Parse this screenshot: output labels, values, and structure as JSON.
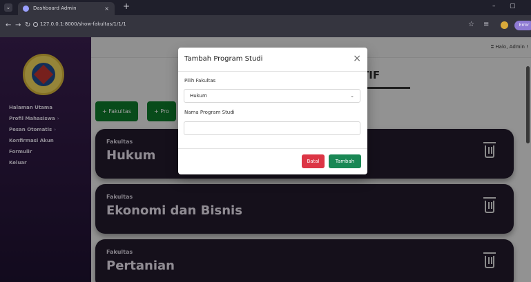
{
  "browser": {
    "tab_title": "Dashboard Admin",
    "tab_close": "×",
    "new_tab": "+",
    "url": "127.0.0.1:8000/show-fakultas/1/1/1",
    "error_badge": "Error",
    "win_min": "–",
    "win_max": "▢"
  },
  "header": {
    "greeting": "ⵓ Halo, Admin !"
  },
  "page": {
    "title": "TIF"
  },
  "sidebar": {
    "items": [
      {
        "label": "Halaman Utama",
        "chev": ""
      },
      {
        "label": "Profil Mahasiswa",
        "chev": "›"
      },
      {
        "label": "Pesan Otomatis",
        "chev": "›"
      },
      {
        "label": "Konfirmasi Akun",
        "chev": ""
      },
      {
        "label": "Formulir",
        "chev": ""
      },
      {
        "label": "Keluar",
        "chev": ""
      }
    ]
  },
  "buttons": {
    "add_faculty": "+ Fakultas",
    "add_program": "+ Pro"
  },
  "cards": [
    {
      "label": "Fakultas",
      "name": "Hukum"
    },
    {
      "label": "Fakultas",
      "name": "Ekonomi dan Bisnis"
    },
    {
      "label": "Fakultas",
      "name": "Pertanian"
    }
  ],
  "modal": {
    "title": "Tambah Program Studi",
    "close": "×",
    "faculty_label": "Pilih Fakultas",
    "faculty_selected": "Hukum",
    "program_label": "Nama Program Studi",
    "program_value": "",
    "cancel": "Batal",
    "submit": "Tambah"
  },
  "colors": {
    "sidebar_top": "#3a1f50",
    "card_bg": "#221b2c",
    "green": "#0e7a2a",
    "danger": "#dc3545",
    "success": "#198754"
  }
}
